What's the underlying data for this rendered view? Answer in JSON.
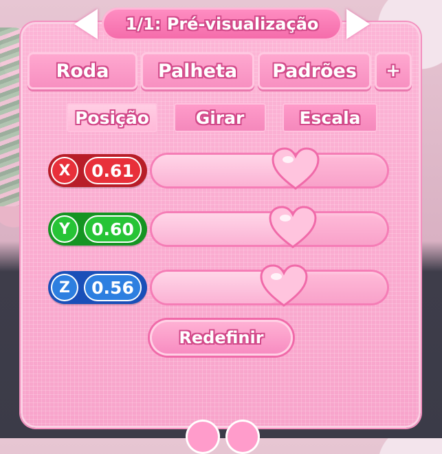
{
  "header": {
    "title": "1/1: Pré-visualização",
    "prev_icon": "arrow-left-icon",
    "next_icon": "arrow-right-icon"
  },
  "tabs": [
    {
      "label": "Roda"
    },
    {
      "label": "Palheta"
    },
    {
      "label": "Padrões"
    },
    {
      "label": "+"
    }
  ],
  "subtabs": [
    {
      "label": "Posição",
      "active": true
    },
    {
      "label": "Girar",
      "active": false
    },
    {
      "label": "Escala",
      "active": false
    }
  ],
  "axes": [
    {
      "letter": "X",
      "value": "0.61",
      "level": 0.61,
      "color": "#e8303a",
      "dark": "#b81d28"
    },
    {
      "letter": "Y",
      "value": "0.60",
      "level": 0.6,
      "color": "#27c436",
      "dark": "#159422"
    },
    {
      "letter": "Z",
      "value": "0.56",
      "level": 0.56,
      "color": "#2d7fe0",
      "dark": "#1a4fb8"
    }
  ],
  "reset_label": "Redefinir",
  "colors": {
    "panel": "#f8a4cb",
    "accent": "#f46aa9",
    "heart": "#ffc4de"
  }
}
